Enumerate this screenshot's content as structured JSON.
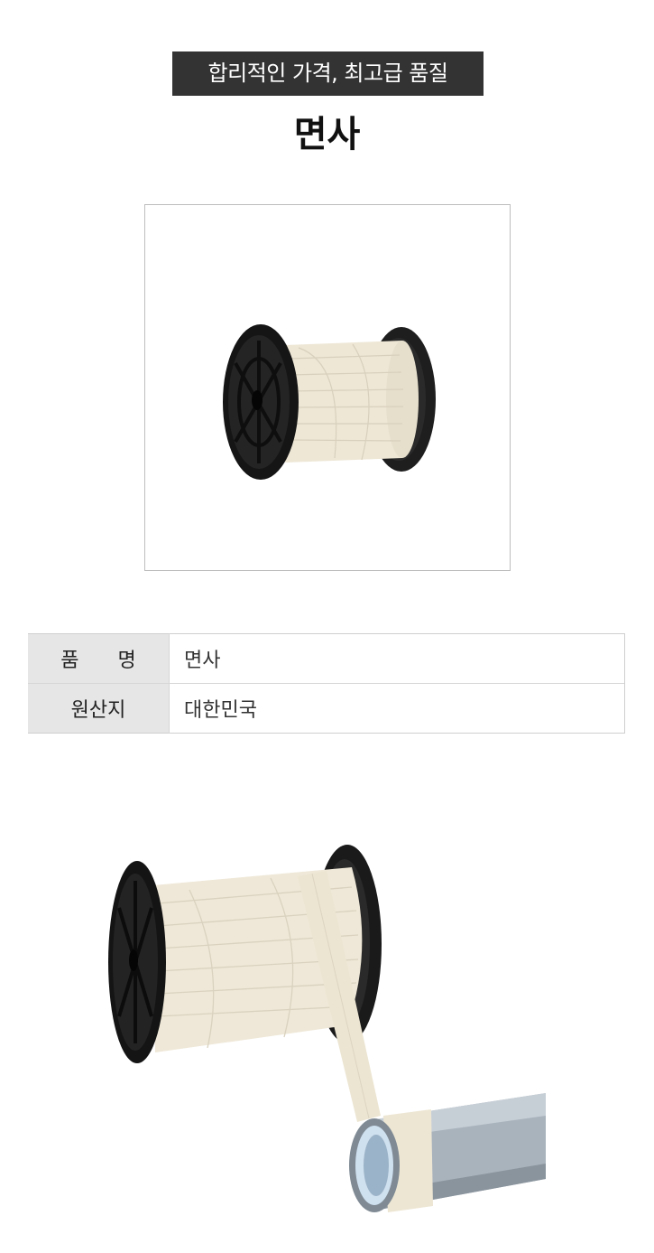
{
  "header": {
    "tagline": "합리적인 가격, 최고급 품질",
    "title": "면사"
  },
  "product_image": {
    "subject": "cotton tape spool on black reel"
  },
  "spec_table": {
    "rows": [
      {
        "label": "품 명",
        "value": "면사"
      },
      {
        "label": "원산지",
        "value": "대한민국"
      }
    ]
  },
  "usage_image": {
    "subject": "cotton tape unwound from spool and wrapped around metal pipe"
  },
  "colors": {
    "tag_bg": "#333333",
    "table_key_bg": "#e6e6e6",
    "reel": "#1c1c1c",
    "cotton": "#efe8d8"
  }
}
